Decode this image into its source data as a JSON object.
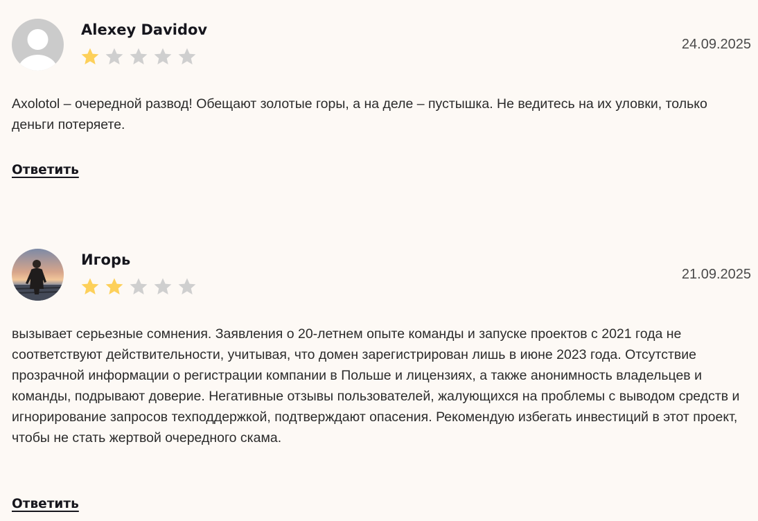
{
  "reviews": [
    {
      "author": "Alexey Davidov",
      "date": "24.09.2025",
      "rating": 1,
      "max_rating": 5,
      "avatar": "default-user-avatar",
      "text": "Axolotol – очередной развод! Обещают золотые горы, а на деле – пустышка. Не ведитесь на их уловки, только деньги потеряете.",
      "reply_label": "Ответить"
    },
    {
      "author": "Игорь",
      "date": "21.09.2025",
      "rating": 2,
      "max_rating": 5,
      "avatar": "user-photo-avatar",
      "text": "вызывает серьезные сомнения. Заявления о 20-летнем опыте команды и запуске проектов с 2021 года не соответствуют действительности, учитывая, что домен зарегистрирован лишь в июне 2023 года. Отсутствие прозрачной информации о регистрации компании в Польше и лицензиях, а также анонимность владельцев и команды, подрывают доверие. Негативные отзывы пользователей, жалующихся на проблемы с выводом средств и игнорирование запросов техподдержкой, подтверждают опасения. Рекомендую избегать инвестиций в этот проект, чтобы не стать жертвой очередного скама.",
      "reply_label": "Ответить"
    }
  ],
  "colors": {
    "background": "#fdf9f5",
    "star_filled": "#fdd05a",
    "star_empty": "#cfcfcf",
    "text": "#2b2b2b",
    "heading": "#16161d"
  }
}
